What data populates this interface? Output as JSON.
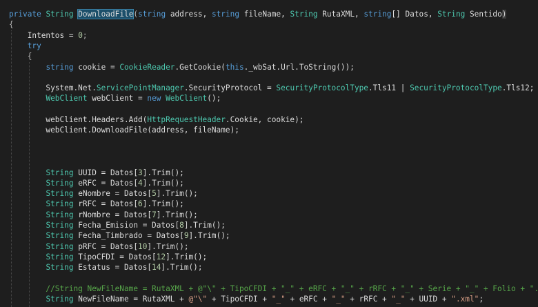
{
  "editor": {
    "language": "csharp",
    "colors": {
      "background": "#1e1e1e",
      "keyword": "#569cd6",
      "type": "#4ec9b0",
      "string": "#d69d85",
      "comment": "#57a64a",
      "number": "#b5cea8",
      "identifier": "#dcdcdc",
      "highlight": "#1c4f6a"
    },
    "lines": [
      {
        "tokens": [
          {
            "t": "private",
            "c": "kw"
          },
          {
            "t": " ",
            "c": "id"
          },
          {
            "t": "String",
            "c": "type"
          },
          {
            "t": " ",
            "c": "id"
          },
          {
            "t": "DownloadFile",
            "c": "hl"
          },
          {
            "t": "(",
            "c": "punct"
          },
          {
            "t": "string",
            "c": "kw"
          },
          {
            "t": " address, ",
            "c": "id"
          },
          {
            "t": "string",
            "c": "kw"
          },
          {
            "t": " fileName, ",
            "c": "id"
          },
          {
            "t": "String",
            "c": "type"
          },
          {
            "t": " RutaXML, ",
            "c": "id"
          },
          {
            "t": "string",
            "c": "kw"
          },
          {
            "t": "[] Datos, ",
            "c": "id"
          },
          {
            "t": "String",
            "c": "type"
          },
          {
            "t": " Sentido",
            "c": "id"
          },
          {
            "t": ")",
            "c": "paren-hl"
          }
        ]
      },
      {
        "tokens": [
          {
            "t": "{",
            "c": "punct"
          }
        ]
      },
      {
        "tokens": [
          {
            "t": "    Intentos = ",
            "c": "id"
          },
          {
            "t": "0",
            "c": "num"
          },
          {
            "t": ";",
            "c": "punct"
          }
        ]
      },
      {
        "tokens": [
          {
            "t": "    ",
            "c": "id"
          },
          {
            "t": "try",
            "c": "kw"
          }
        ]
      },
      {
        "tokens": [
          {
            "t": "    {",
            "c": "punct"
          }
        ]
      },
      {
        "tokens": [
          {
            "t": "        ",
            "c": "id"
          },
          {
            "t": "string",
            "c": "kw"
          },
          {
            "t": " cookie = ",
            "c": "id"
          },
          {
            "t": "CookieReader",
            "c": "type"
          },
          {
            "t": ".GetCookie(",
            "c": "id"
          },
          {
            "t": "this",
            "c": "kw"
          },
          {
            "t": "._wbSat.Url.ToString());",
            "c": "id"
          }
        ]
      },
      {
        "tokens": []
      },
      {
        "tokens": [
          {
            "t": "        System.Net.",
            "c": "id"
          },
          {
            "t": "ServicePointManager",
            "c": "type"
          },
          {
            "t": ".SecurityProtocol = ",
            "c": "id"
          },
          {
            "t": "SecurityProtocolType",
            "c": "type"
          },
          {
            "t": ".Tls11 | ",
            "c": "id"
          },
          {
            "t": "SecurityProtocolType",
            "c": "type"
          },
          {
            "t": ".Tls12;",
            "c": "id"
          }
        ]
      },
      {
        "tokens": [
          {
            "t": "        ",
            "c": "id"
          },
          {
            "t": "WebClient",
            "c": "type"
          },
          {
            "t": " webClient = ",
            "c": "id"
          },
          {
            "t": "new",
            "c": "kw"
          },
          {
            "t": " ",
            "c": "id"
          },
          {
            "t": "WebClient",
            "c": "type"
          },
          {
            "t": "();",
            "c": "id"
          }
        ]
      },
      {
        "tokens": []
      },
      {
        "tokens": [
          {
            "t": "        webClient.Headers.Add(",
            "c": "id"
          },
          {
            "t": "HttpRequestHeader",
            "c": "type"
          },
          {
            "t": ".Cookie, cookie);",
            "c": "id"
          }
        ]
      },
      {
        "tokens": [
          {
            "t": "        webClient.DownloadFile(address, fileName);",
            "c": "id"
          }
        ]
      },
      {
        "tokens": []
      },
      {
        "tokens": []
      },
      {
        "tokens": []
      },
      {
        "tokens": [
          {
            "t": "        ",
            "c": "id"
          },
          {
            "t": "String",
            "c": "type"
          },
          {
            "t": " UUID = Datos[",
            "c": "id"
          },
          {
            "t": "3",
            "c": "num"
          },
          {
            "t": "].Trim();",
            "c": "id"
          }
        ]
      },
      {
        "tokens": [
          {
            "t": "        ",
            "c": "id"
          },
          {
            "t": "String",
            "c": "type"
          },
          {
            "t": " eRFC = Datos[",
            "c": "id"
          },
          {
            "t": "4",
            "c": "num"
          },
          {
            "t": "].Trim();",
            "c": "id"
          }
        ]
      },
      {
        "tokens": [
          {
            "t": "        ",
            "c": "id"
          },
          {
            "t": "String",
            "c": "type"
          },
          {
            "t": " eNombre = Datos[",
            "c": "id"
          },
          {
            "t": "5",
            "c": "num"
          },
          {
            "t": "].Trim();",
            "c": "id"
          }
        ]
      },
      {
        "tokens": [
          {
            "t": "        ",
            "c": "id"
          },
          {
            "t": "String",
            "c": "type"
          },
          {
            "t": " rRFC = Datos[",
            "c": "id"
          },
          {
            "t": "6",
            "c": "num"
          },
          {
            "t": "].Trim();",
            "c": "id"
          }
        ]
      },
      {
        "tokens": [
          {
            "t": "        ",
            "c": "id"
          },
          {
            "t": "String",
            "c": "type"
          },
          {
            "t": " rNombre = Datos[",
            "c": "id"
          },
          {
            "t": "7",
            "c": "num"
          },
          {
            "t": "].Trim();",
            "c": "id"
          }
        ]
      },
      {
        "tokens": [
          {
            "t": "        ",
            "c": "id"
          },
          {
            "t": "String",
            "c": "type"
          },
          {
            "t": " Fecha_Emision = Datos[",
            "c": "id"
          },
          {
            "t": "8",
            "c": "num"
          },
          {
            "t": "].Trim();",
            "c": "id"
          }
        ]
      },
      {
        "tokens": [
          {
            "t": "        ",
            "c": "id"
          },
          {
            "t": "String",
            "c": "type"
          },
          {
            "t": " Fecha_Timbrado = Datos[",
            "c": "id"
          },
          {
            "t": "9",
            "c": "num"
          },
          {
            "t": "].Trim();",
            "c": "id"
          }
        ]
      },
      {
        "tokens": [
          {
            "t": "        ",
            "c": "id"
          },
          {
            "t": "String",
            "c": "type"
          },
          {
            "t": " pRFC = Datos[",
            "c": "id"
          },
          {
            "t": "10",
            "c": "num"
          },
          {
            "t": "].Trim();",
            "c": "id"
          }
        ]
      },
      {
        "tokens": [
          {
            "t": "        ",
            "c": "id"
          },
          {
            "t": "String",
            "c": "type"
          },
          {
            "t": " TipoCFDI = Datos[",
            "c": "id"
          },
          {
            "t": "12",
            "c": "num"
          },
          {
            "t": "].Trim();",
            "c": "id"
          }
        ]
      },
      {
        "tokens": [
          {
            "t": "        ",
            "c": "id"
          },
          {
            "t": "String",
            "c": "type"
          },
          {
            "t": " Estatus = Datos[",
            "c": "id"
          },
          {
            "t": "14",
            "c": "num"
          },
          {
            "t": "].Trim();",
            "c": "id"
          }
        ]
      },
      {
        "tokens": []
      },
      {
        "tokens": [
          {
            "t": "        //String NewFileName = RutaXML + @\"\\\" + TipoCFDI + \"_\" + eRFC + \"_\" + rRFC + \"_\" + Serie + \"_\" + Folio + \".xml\";",
            "c": "com"
          }
        ]
      },
      {
        "tokens": [
          {
            "t": "        ",
            "c": "id"
          },
          {
            "t": "String",
            "c": "type"
          },
          {
            "t": " NewFileName = RutaXML + ",
            "c": "id"
          },
          {
            "t": "@\"\\\"",
            "c": "str"
          },
          {
            "t": " + TipoCFDI + ",
            "c": "id"
          },
          {
            "t": "\"_\"",
            "c": "str"
          },
          {
            "t": " + eRFC + ",
            "c": "id"
          },
          {
            "t": "\"_\"",
            "c": "str"
          },
          {
            "t": " + rRFC + ",
            "c": "id"
          },
          {
            "t": "\"_\"",
            "c": "str"
          },
          {
            "t": " + UUID + ",
            "c": "id"
          },
          {
            "t": "\".xml\"",
            "c": "str"
          },
          {
            "t": ";",
            "c": "id"
          }
        ]
      }
    ]
  }
}
